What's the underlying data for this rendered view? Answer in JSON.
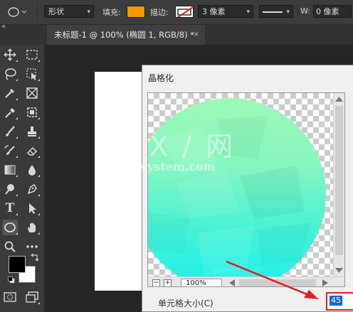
{
  "options_bar": {
    "shape_mode": "形状",
    "fill_label": "填充:",
    "fill_color": "#f29a00",
    "stroke_label": "描边:",
    "stroke_width": "3 像素",
    "w_label": "W:",
    "w_value": "0 像素"
  },
  "document_tab": {
    "title": "未标题-1 @ 100% (椭圆 1, RGB/8) *",
    "close_glyph": "×"
  },
  "toolbar": {
    "collapse_glyph": "«",
    "text_tool_glyph": "T"
  },
  "dialog": {
    "title": "晶格化",
    "zoom_value": "100%",
    "zoom_out_glyph": "−",
    "zoom_in_glyph": "+",
    "cell_size_label": "单元格大小(C)",
    "cell_size_value": "45"
  },
  "watermark": {
    "glyph": "X / 网",
    "text": "system.com"
  },
  "colors": {
    "foreground": "#000000",
    "background": "#ffffff",
    "annotation_arrow": "#e02020",
    "selection": "#1565d8"
  }
}
